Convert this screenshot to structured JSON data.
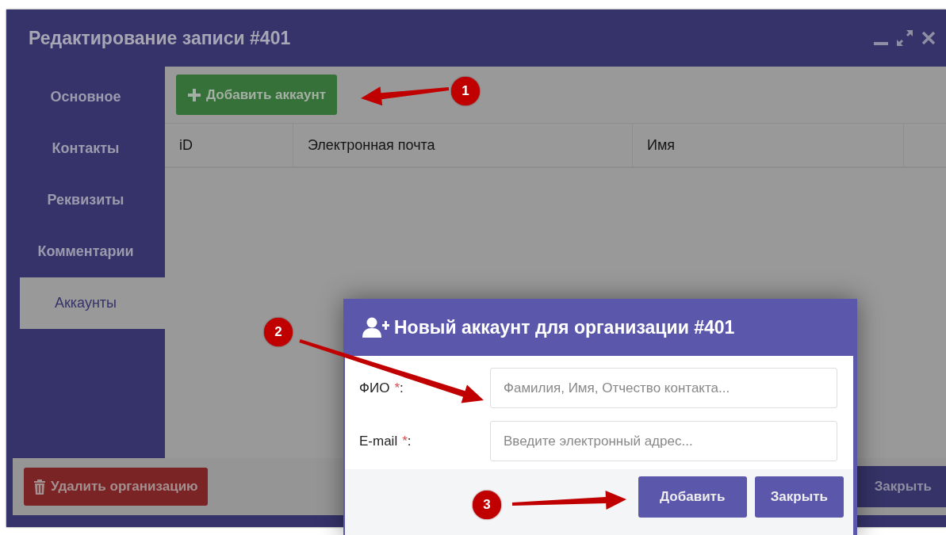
{
  "window": {
    "title": "Редактирование записи #401"
  },
  "sidebar": {
    "items": [
      {
        "label": "Основное",
        "selected": false
      },
      {
        "label": "Контакты",
        "selected": false
      },
      {
        "label": "Реквизиты",
        "selected": false
      },
      {
        "label": "Комментарии",
        "selected": false
      },
      {
        "label": "Аккаунты",
        "selected": true
      }
    ]
  },
  "toolbar": {
    "add_button": "Добавить аккаунт"
  },
  "table": {
    "columns": [
      "iD",
      "Электронная почта",
      "Имя"
    ]
  },
  "footer": {
    "delete_button": "Удалить организацию",
    "close_button": "Закрыть"
  },
  "dialog": {
    "title": "Новый аккаунт для организации #401",
    "fields": [
      {
        "label": "ФИО",
        "mark": "*",
        "colon": ":",
        "placeholder": "Фамилия, Имя, Отчество контакта..."
      },
      {
        "label": "E-mail",
        "mark": "*",
        "colon": ":",
        "placeholder": "Введите электронный адрес..."
      }
    ],
    "buttons": [
      "Добавить",
      "Закрыть"
    ]
  },
  "callouts": [
    {
      "number": "1"
    },
    {
      "number": "2"
    },
    {
      "number": "3"
    }
  ]
}
